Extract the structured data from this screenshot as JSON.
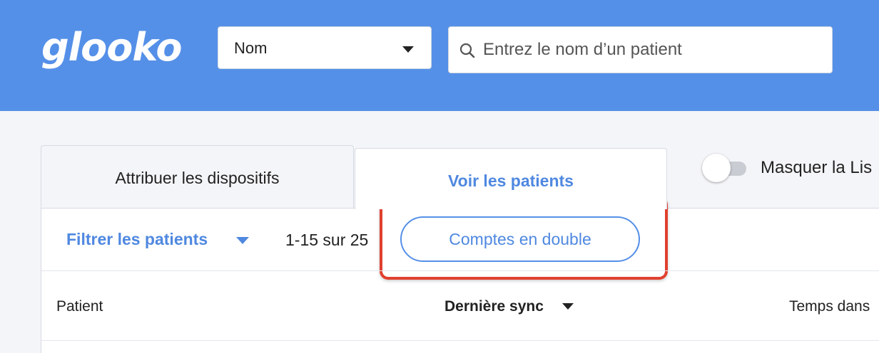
{
  "header": {
    "logo_text": "glooko",
    "search_type": {
      "selected": "Nom"
    },
    "search": {
      "placeholder": "Entrez le nom d’un patient",
      "value": ""
    },
    "brand_color": "#5590e8"
  },
  "tabs": [
    {
      "label": "Attribuer les dispositifs",
      "active": false
    },
    {
      "label": "Voir les patients",
      "active": true
    }
  ],
  "toggle": {
    "label": "Masquer la Lis",
    "checked": false
  },
  "toolbar": {
    "filter_label": "Filtrer les patients",
    "count_text": "1-15 sur 25",
    "duplicate_accounts_label": "Comptes en double"
  },
  "table": {
    "columns": [
      {
        "label": "Patient"
      },
      {
        "label": "Dernière sync",
        "sorted": "desc"
      },
      {
        "label": "Temps dans"
      }
    ]
  },
  "annotation_color": "#e0402f"
}
